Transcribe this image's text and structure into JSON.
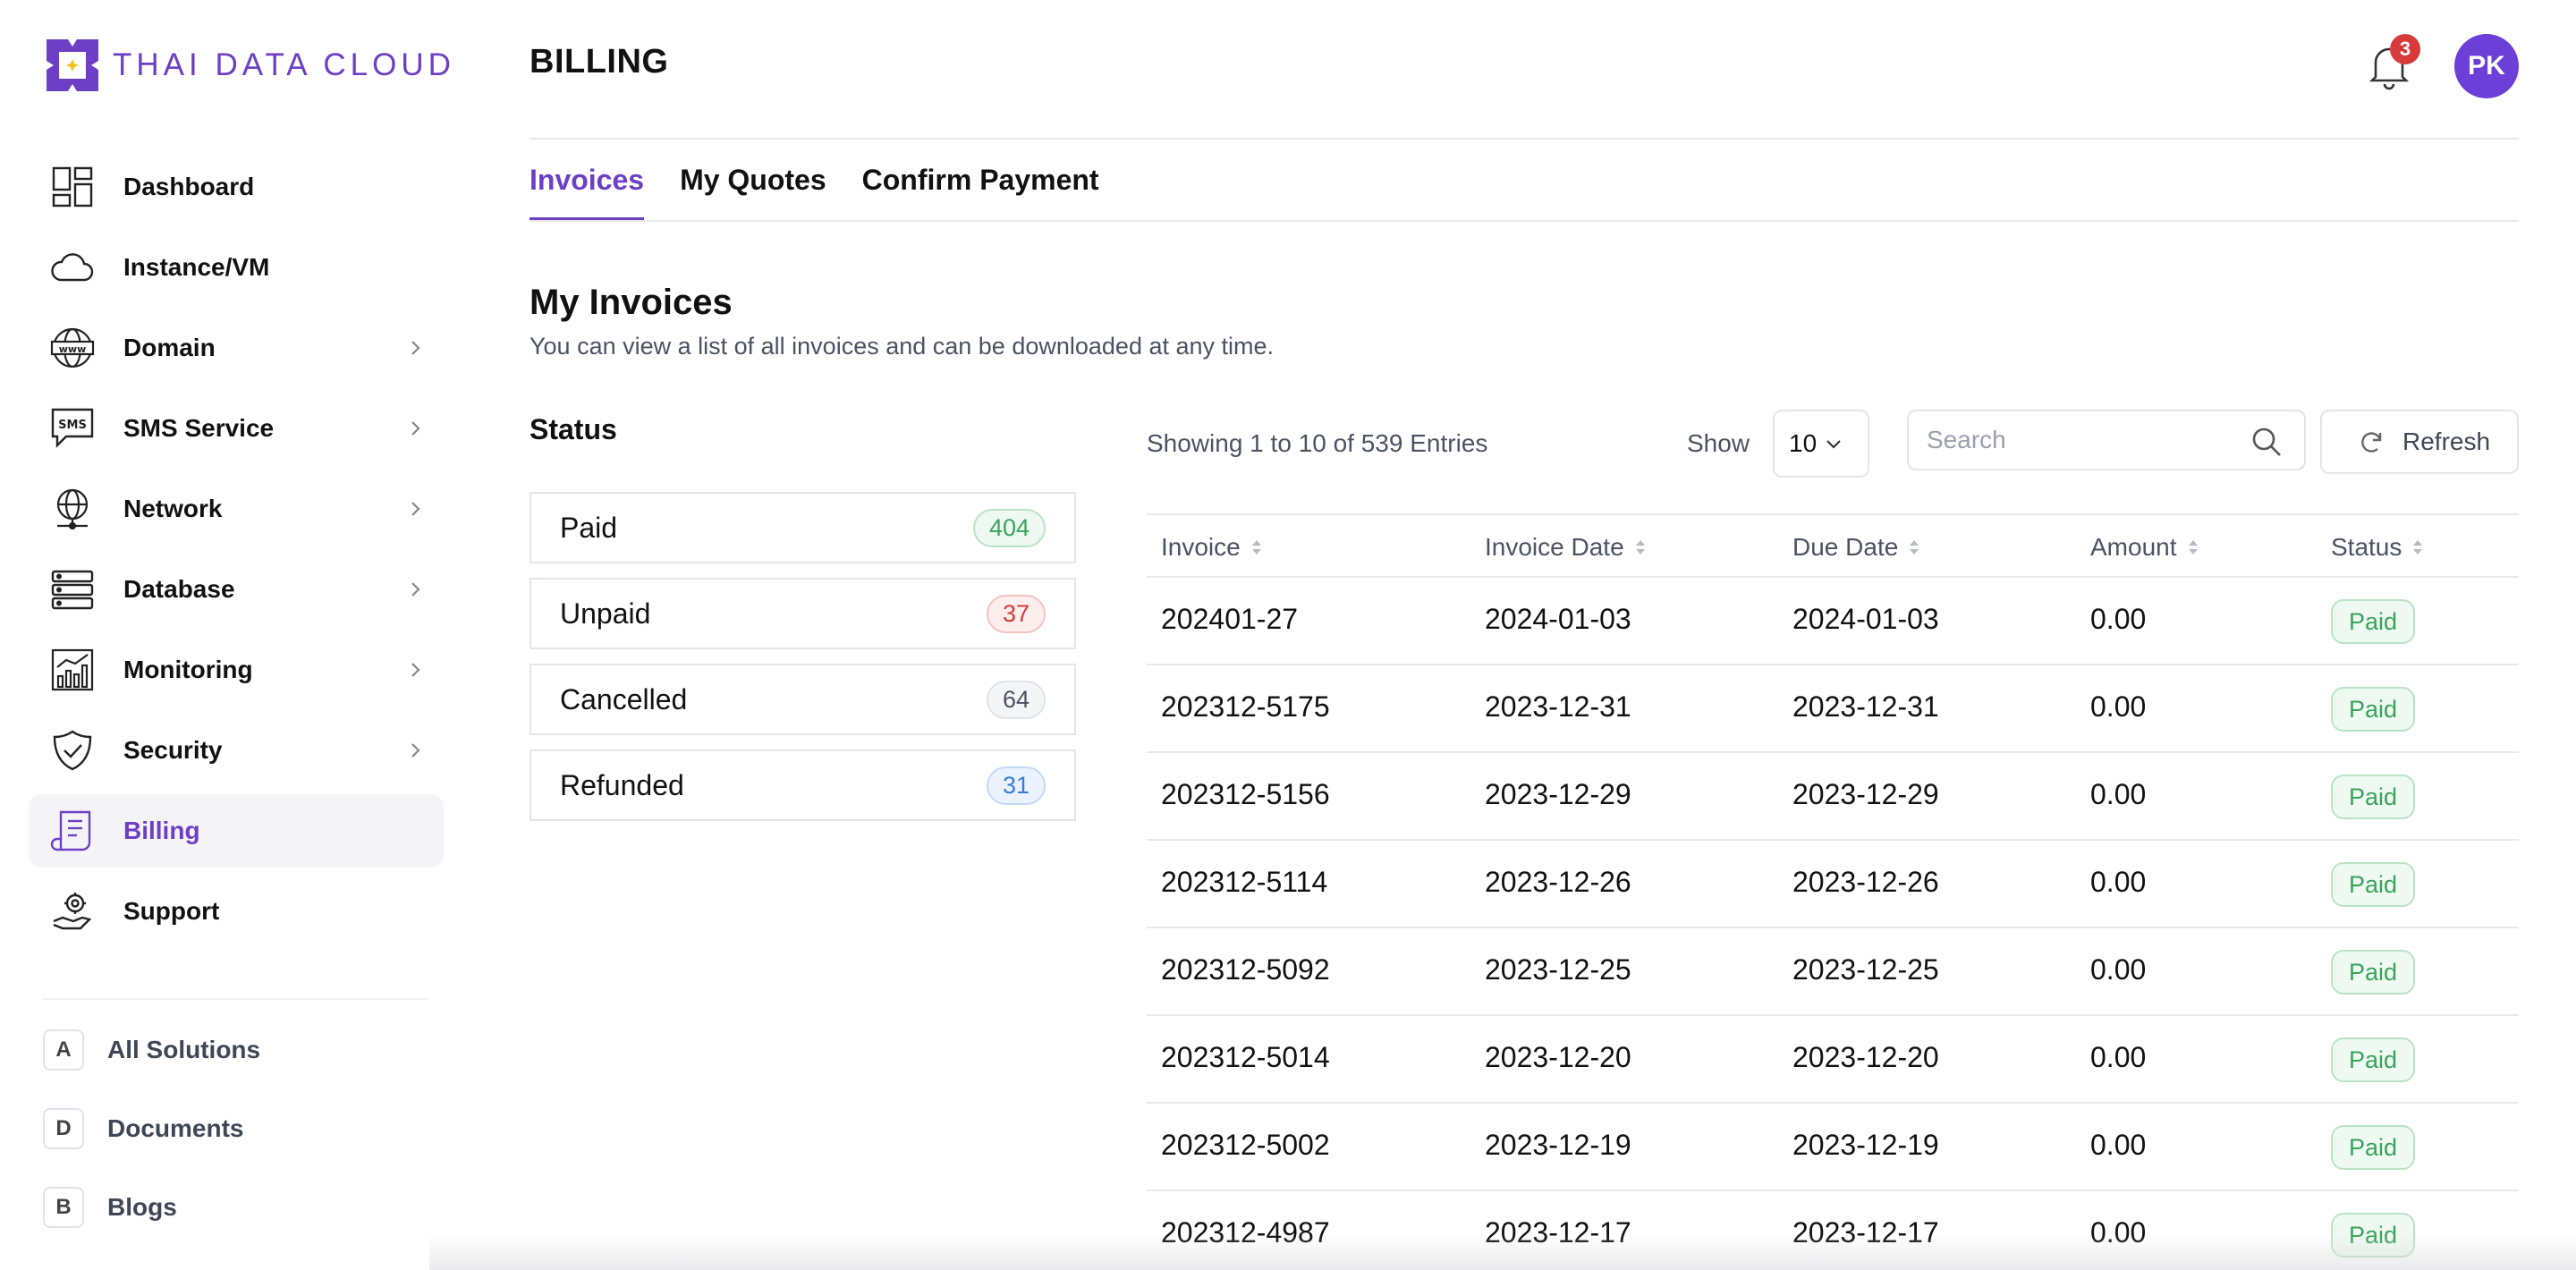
{
  "brand": {
    "name": "THAI DATA CLOUD",
    "accent": "#6c3fc4"
  },
  "header": {
    "title": "BILLING",
    "notifications": "3",
    "avatar_initials": "PK"
  },
  "sidebar": {
    "items": [
      {
        "label": "Dashboard",
        "icon": "dashboard-icon",
        "chevron": false
      },
      {
        "label": "Instance/VM",
        "icon": "cloud-icon",
        "chevron": false
      },
      {
        "label": "Domain",
        "icon": "globe-www-icon",
        "chevron": true
      },
      {
        "label": "SMS Service",
        "icon": "sms-icon",
        "chevron": true
      },
      {
        "label": "Network",
        "icon": "network-globe-icon",
        "chevron": true
      },
      {
        "label": "Database",
        "icon": "database-icon",
        "chevron": true
      },
      {
        "label": "Monitoring",
        "icon": "monitoring-chart-icon",
        "chevron": true
      },
      {
        "label": "Security",
        "icon": "security-shield-icon",
        "chevron": true
      },
      {
        "label": "Billing",
        "icon": "billing-receipt-icon",
        "chevron": false,
        "active": true
      },
      {
        "label": "Support",
        "icon": "support-hand-icon",
        "chevron": false
      }
    ],
    "solutions": [
      {
        "badge": "A",
        "label": "All Solutions"
      },
      {
        "badge": "D",
        "label": "Documents"
      },
      {
        "badge": "B",
        "label": "Blogs"
      }
    ]
  },
  "tabs": [
    {
      "label": "Invoices",
      "active": true
    },
    {
      "label": "My Quotes"
    },
    {
      "label": "Confirm Payment"
    }
  ],
  "section": {
    "title": "My Invoices",
    "description": "You can view a list of all invoices and can be downloaded at any time."
  },
  "status_panel": {
    "heading": "Status",
    "items": [
      {
        "label": "Paid",
        "count": "404",
        "color": "#3aa35b",
        "bg": "#eef9f1",
        "border": "#b9e3c4"
      },
      {
        "label": "Unpaid",
        "count": "37",
        "color": "#d63a3a",
        "bg": "#fdeeee",
        "border": "#f2c2c2"
      },
      {
        "label": "Cancelled",
        "count": "64",
        "color": "#4a5263",
        "bg": "#f4f5f7",
        "border": "#dfe2e8"
      },
      {
        "label": "Refunded",
        "count": "31",
        "color": "#3a7bd6",
        "bg": "#eaf2fd",
        "border": "#c2d9f5"
      }
    ]
  },
  "toolbar": {
    "showing": "Showing 1 to 10 of 539 Entries",
    "show_label": "Show",
    "page_size": "10",
    "search_placeholder": "Search",
    "refresh_label": "Refresh"
  },
  "table": {
    "columns": [
      "Invoice",
      "Invoice Date",
      "Due Date",
      "Amount",
      "Status"
    ],
    "rows": [
      {
        "invoice": "202401-27",
        "invoice_date": "2024-01-03",
        "due_date": "2024-01-03",
        "amount": "0.00",
        "status": "Paid"
      },
      {
        "invoice": "202312-5175",
        "invoice_date": "2023-12-31",
        "due_date": "2023-12-31",
        "amount": "0.00",
        "status": "Paid"
      },
      {
        "invoice": "202312-5156",
        "invoice_date": "2023-12-29",
        "due_date": "2023-12-29",
        "amount": "0.00",
        "status": "Paid"
      },
      {
        "invoice": "202312-5114",
        "invoice_date": "2023-12-26",
        "due_date": "2023-12-26",
        "amount": "0.00",
        "status": "Paid"
      },
      {
        "invoice": "202312-5092",
        "invoice_date": "2023-12-25",
        "due_date": "2023-12-25",
        "amount": "0.00",
        "status": "Paid"
      },
      {
        "invoice": "202312-5014",
        "invoice_date": "2023-12-20",
        "due_date": "2023-12-20",
        "amount": "0.00",
        "status": "Paid"
      },
      {
        "invoice": "202312-5002",
        "invoice_date": "2023-12-19",
        "due_date": "2023-12-19",
        "amount": "0.00",
        "status": "Paid"
      },
      {
        "invoice": "202312-4987",
        "invoice_date": "2023-12-17",
        "due_date": "2023-12-17",
        "amount": "0.00",
        "status": "Paid"
      }
    ]
  }
}
